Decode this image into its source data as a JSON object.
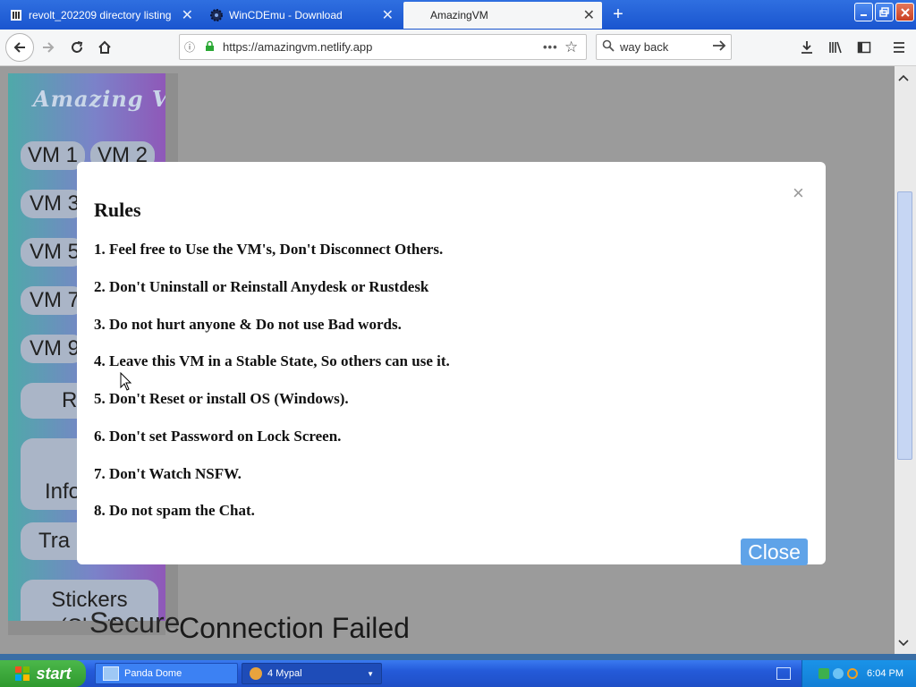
{
  "browser": {
    "tabs": [
      {
        "label": "revolt_202209 directory listing",
        "icon": "archive-icon"
      },
      {
        "label": "WinCDEmu - Download",
        "icon": "gear-icon"
      },
      {
        "label": "AmazingVM",
        "icon": "none"
      }
    ],
    "new_tab_glyph": "+",
    "url": "https://amazingvm.netlify.app",
    "search_value": "way back",
    "window_controls": [
      "minimize",
      "maximize",
      "close"
    ]
  },
  "page": {
    "sidebar_logo": "Amazing VM",
    "sidebar_buttons": [
      "VM 1",
      "VM 2",
      "VM 3",
      "VM 5",
      "VM 7",
      "VM 9",
      "R",
      "Info",
      "Tra",
      "Stickers (Chat)"
    ],
    "background_text": "Connection Failed",
    "partial_background_text": "Secure"
  },
  "modal": {
    "title": "Rules",
    "close_glyph": "×",
    "rules": [
      "1. Feel free to Use the VM's, Don't Disconnect Others.",
      "2. Don't Uninstall or Reinstall Anydesk or Rustdesk",
      "3. Do not hurt anyone & Do not use Bad words.",
      "4. Leave this VM in a Stable State, So others can use it.",
      "5. Don't Reset or install OS (Windows).",
      "6. Don't set Password on Lock Screen.",
      "7. Don't Watch NSFW.",
      "8. Do not spam the Chat."
    ],
    "close_button": "Close"
  },
  "taskbar": {
    "start_label": "start",
    "items": [
      {
        "label": "Panda Dome",
        "icon": "panda-icon"
      },
      {
        "label": "4 Mypal",
        "icon": "mypal-icon"
      }
    ],
    "clock": "6:04 PM"
  },
  "colors": {
    "accent": "#5fa3e8",
    "xp_blue": "#245ad9",
    "start_green": "#2f9a2e"
  }
}
